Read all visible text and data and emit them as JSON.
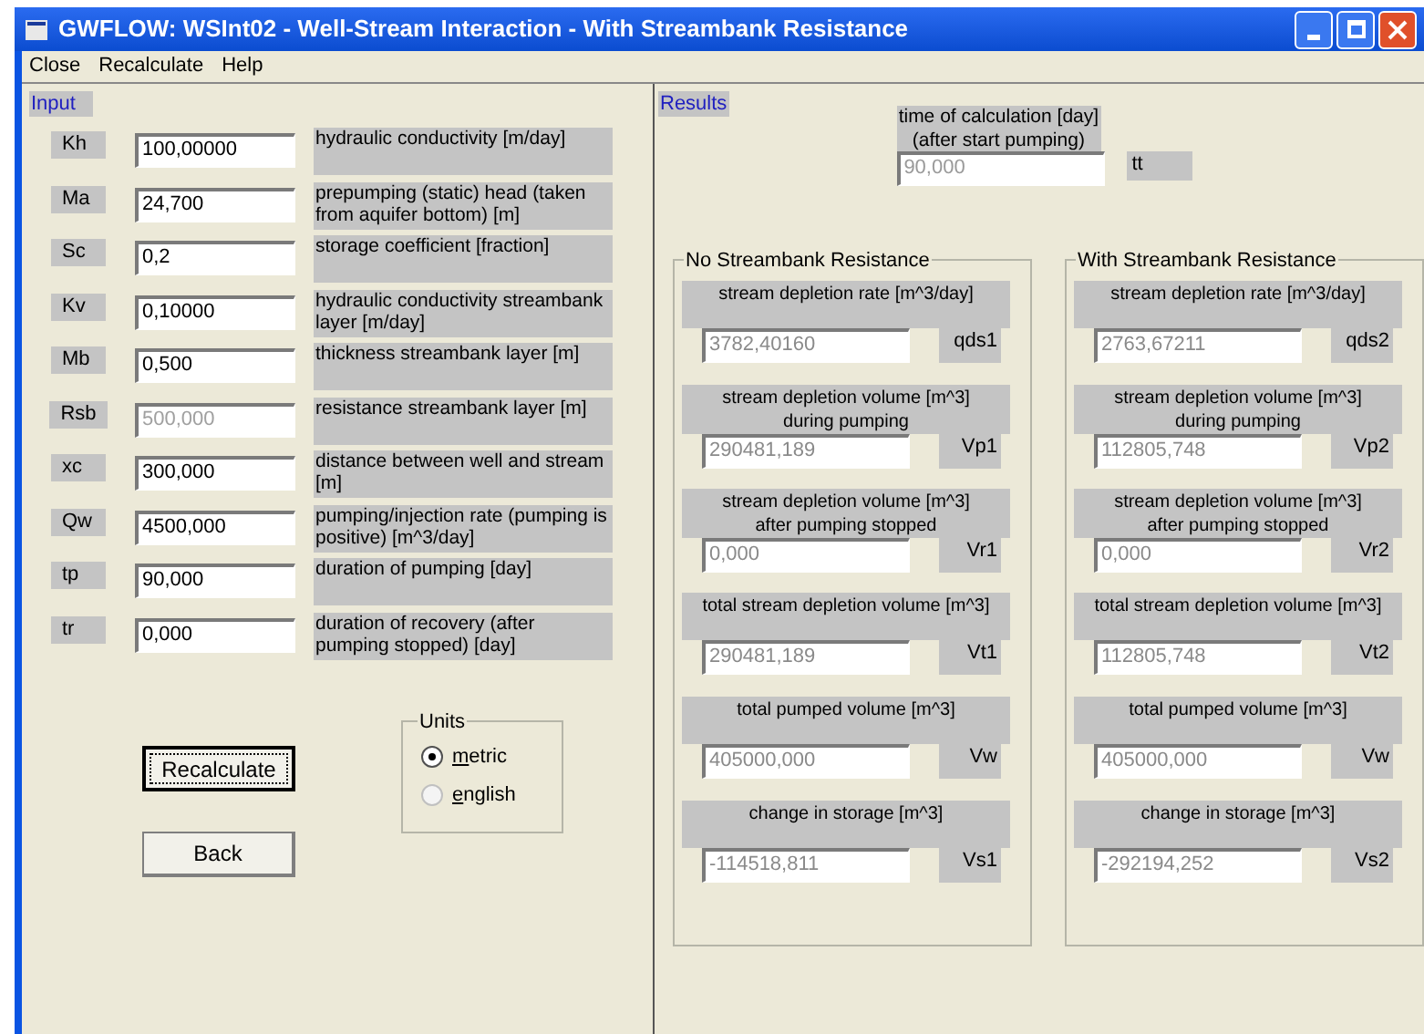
{
  "window": {
    "title": "GWFLOW: WSInt02 - Well-Stream Interaction - With Streambank Resistance"
  },
  "menu": [
    "Close",
    "Recalculate",
    "Help"
  ],
  "input": {
    "title": "Input",
    "params": [
      {
        "symbol": "Kh",
        "value": "100,00000",
        "description": "hydraulic conductivity [m/day]",
        "disabled": false
      },
      {
        "symbol": "Ma",
        "value": "24,700",
        "description": "prepumping (static) head (taken from aquifer bottom) [m]",
        "disabled": false
      },
      {
        "symbol": "Sc",
        "value": "0,2",
        "description": "storage coefficient [fraction]",
        "disabled": false
      },
      {
        "symbol": "Kv",
        "value": "0,10000",
        "description": "hydraulic conductivity streambank layer [m/day]",
        "disabled": false
      },
      {
        "symbol": "Mb",
        "value": "0,500",
        "description": "thickness streambank layer [m]",
        "disabled": false
      },
      {
        "symbol": "Rsb",
        "value": "500,000",
        "description": "resistance streambank layer [m]",
        "disabled": true
      },
      {
        "symbol": "xc",
        "value": "300,000",
        "description": "distance between well and stream [m]",
        "disabled": false
      },
      {
        "symbol": "Qw",
        "value": "4500,000",
        "description": "pumping/injection rate (pumping is positive) [m^3/day]",
        "disabled": false
      },
      {
        "symbol": "tp",
        "value": "90,000",
        "description": "duration of pumping [day]",
        "disabled": false
      },
      {
        "symbol": "tr",
        "value": "0,000",
        "description": "duration of recovery (after pumping stopped) [day]",
        "disabled": false
      }
    ],
    "buttons": [
      {
        "label": "Recalculate",
        "focused": true
      },
      {
        "label": "Back",
        "focused": false
      }
    ],
    "units": {
      "title": "Units",
      "options": [
        {
          "label": "metric",
          "selected": true
        },
        {
          "label": "english",
          "selected": false
        }
      ]
    }
  },
  "results": {
    "title": "Results",
    "time": {
      "label": "time of calculation [day]\n(after start pumping)",
      "value": "90,000",
      "symbol": "tt"
    },
    "groups": [
      {
        "title": "No Streambank Resistance",
        "items": [
          {
            "label": "stream depletion rate [m^3/day]",
            "value": "3782,40160",
            "symbol": "qds1"
          },
          {
            "label": "stream depletion volume [m^3]\nduring pumping",
            "value": "290481,189",
            "symbol": "Vp1"
          },
          {
            "label": "stream depletion volume [m^3]\nafter pumping stopped",
            "value": "0,000",
            "symbol": "Vr1"
          },
          {
            "label": "total stream depletion volume  [m^3]",
            "value": "290481,189",
            "symbol": "Vt1"
          },
          {
            "label": "total pumped volume  [m^3]",
            "value": "405000,000",
            "symbol": "Vw"
          },
          {
            "label": "change in storage [m^3]",
            "value": "-114518,811",
            "symbol": "Vs1"
          }
        ]
      },
      {
        "title": "With Streambank Resistance",
        "items": [
          {
            "label": "stream depletion rate [m^3/day]",
            "value": "2763,67211",
            "symbol": "qds2"
          },
          {
            "label": "stream depletion volume [m^3]\nduring pumping",
            "value": "112805,748",
            "symbol": "Vp2"
          },
          {
            "label": "stream depletion volume [m^3]\nafter pumping stopped",
            "value": "0,000",
            "symbol": "Vr2"
          },
          {
            "label": "total stream depletion volume  [m^3]",
            "value": "112805,748",
            "symbol": "Vt2"
          },
          {
            "label": "total pumped volume  [m^3]",
            "value": "405000,000",
            "symbol": "Vw"
          },
          {
            "label": "change in storage [m^3]",
            "value": "-292194,252",
            "symbol": "Vs2"
          }
        ]
      }
    ]
  }
}
